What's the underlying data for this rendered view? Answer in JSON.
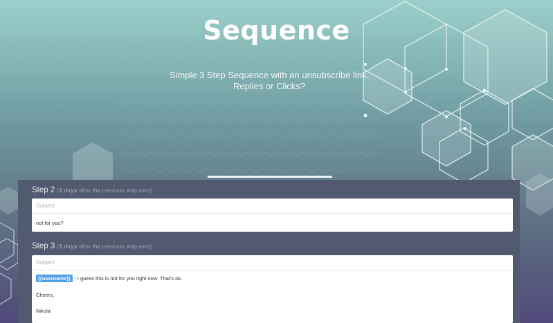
{
  "hero": {
    "title": "Sequence",
    "subtitle_line1": "Simple 3 Step Sequence with an unsubscribe link.",
    "subtitle_line2": "Replies or Clicks?"
  },
  "progress": {
    "value": 1.0
  },
  "colors": {
    "panel": "#525a70",
    "tag": "#4f9fe4",
    "bg_top": "#9ccfcb",
    "bg_bottom": "#51487a"
  },
  "steps": [
    {
      "label": "Step 2",
      "days_value": "2 days",
      "days_text": "after the previous step sent",
      "subject_placeholder": "Subject",
      "body": "not for you?"
    },
    {
      "label": "Step 3",
      "days_value": "3 days",
      "days_text": "after the previous step sent",
      "subject_placeholder": "Subject",
      "tag": "{{username}}",
      "body_line1": "- I guess this is not for you right now. That's ok.",
      "body_line2": "Cheers,",
      "body_line3": "Nikola"
    }
  ]
}
